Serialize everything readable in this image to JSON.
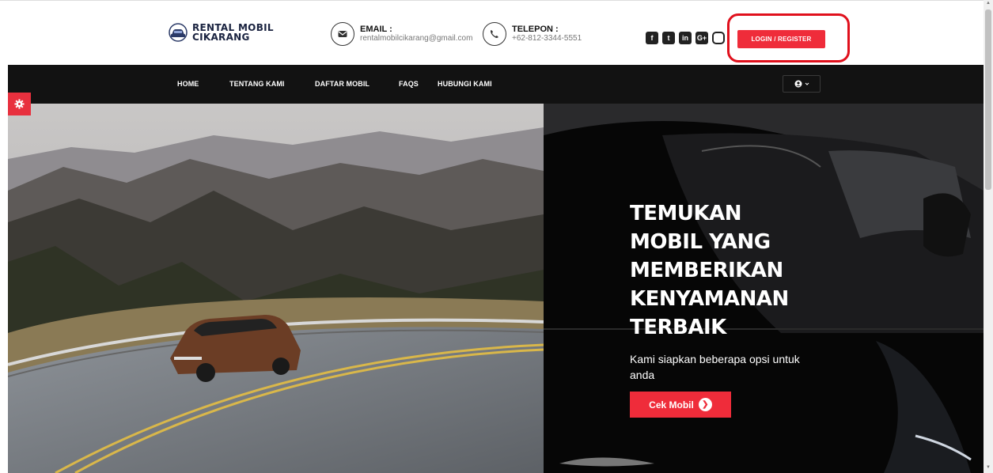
{
  "logo": {
    "line1": "RENTAL MOBIL",
    "line2": "CIKARANG"
  },
  "contact": {
    "email": {
      "label": "EMAIL :",
      "value": "rentalmobilcikarang@gmail.com"
    },
    "phone": {
      "label": "TELEPON :",
      "value": "+62-812-3344-5551"
    }
  },
  "socials": {
    "facebook": "f",
    "twitter": "t",
    "linkedin": "in",
    "google": "G+"
  },
  "login_label": "LOGIN / REGISTER",
  "nav": {
    "home": "HOME",
    "about": "TENTANG KAMI",
    "cars": "DAFTAR MOBIL",
    "faqs": "FAQS",
    "contact": "HUBUNGI KAMI"
  },
  "hero": {
    "title_lines": [
      "TEMUKAN",
      "MOBIL YANG",
      "MEMBERIKAN",
      "KENYAMANAN",
      "TERBAIK"
    ],
    "subtitle": "Kami siapkan beberapa opsi untuk anda",
    "cta": "Cek Mobil"
  },
  "colors": {
    "accent": "#ef2c3a",
    "nav_bg": "#121212",
    "annotation": "#e0101c"
  }
}
